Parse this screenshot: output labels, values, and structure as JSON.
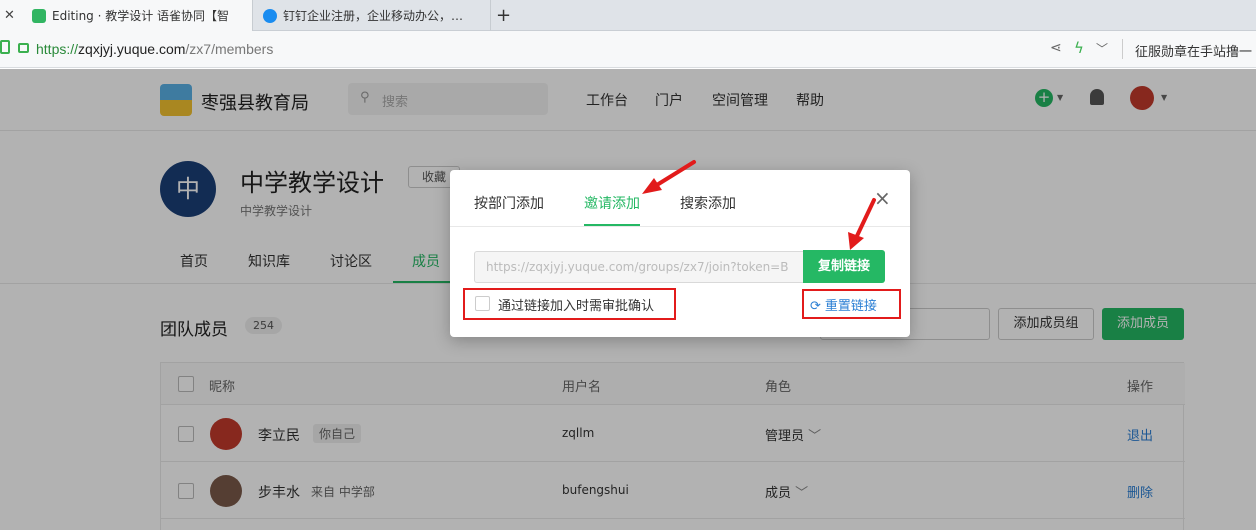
{
  "browser": {
    "tabs": [
      {
        "title": "Editing · 教学设计 语雀协同【智",
        "active": true
      },
      {
        "title": "钉钉企业注册，企业移动办公，…",
        "active": false
      }
    ],
    "new_tab": "+",
    "url": {
      "scheme": "https://",
      "host": "zqxjyj.yuque.com",
      "path": "/zx7/members"
    },
    "right_text": "征服勋章在手站撸一"
  },
  "header": {
    "org_name": "枣强县教育局",
    "search_placeholder": "搜索",
    "nav": [
      "工作台",
      "门户",
      "空间管理",
      "帮助"
    ]
  },
  "space": {
    "avatar_char": "中",
    "title": "中学教学设计",
    "subtitle": "中学教学设计",
    "favorite": "收藏",
    "tabs": [
      "首页",
      "知识库",
      "讨论区",
      "成员"
    ],
    "active_tab": "成员"
  },
  "members": {
    "title": "团队成员",
    "count": "254",
    "add_group": "添加成员组",
    "add_member": "添加成员",
    "columns": [
      "昵称",
      "用户名",
      "角色",
      "操作"
    ],
    "rows": [
      {
        "name": "李立民",
        "tag": "你自己",
        "username": "zqllm",
        "role": "管理员",
        "action": "退出"
      },
      {
        "name": "步丰水",
        "tag": "来自 中学部",
        "username": "bufengshui",
        "role": "成员",
        "action": "删除"
      }
    ]
  },
  "modal": {
    "tabs": [
      "按部门添加",
      "邀请添加",
      "搜索添加"
    ],
    "active_tab": "邀请添加",
    "invite_link": "https://zqxjyj.yuque.com/groups/zx7/join?token=B",
    "copy_button": "复制链接",
    "approval_label": "通过链接加入时需审批确认",
    "reset_link": "重置链接",
    "close": "×"
  },
  "colors": {
    "accent": "#25b864",
    "link": "#2b7fd4",
    "annotation": "#e21b1b"
  }
}
